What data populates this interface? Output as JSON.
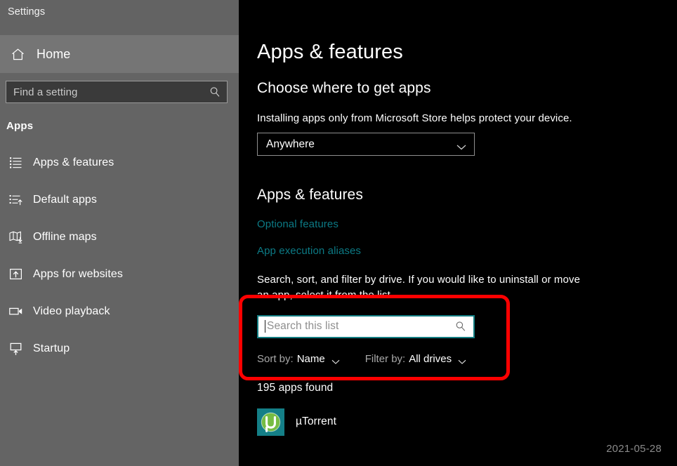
{
  "window": {
    "title": "Settings"
  },
  "sidebar": {
    "home": {
      "label": "Home",
      "icon": "home-icon"
    },
    "search": {
      "placeholder": "Find a setting",
      "value": "",
      "icon": "search-icon"
    },
    "section_header": "Apps",
    "items": [
      {
        "label": "Apps & features",
        "icon": "list-bullet-icon",
        "selected": true
      },
      {
        "label": "Default apps",
        "icon": "list-arrow-icon",
        "selected": false
      },
      {
        "label": "Offline maps",
        "icon": "map-download-icon",
        "selected": false
      },
      {
        "label": "Apps for websites",
        "icon": "box-upload-icon",
        "selected": false
      },
      {
        "label": "Video playback",
        "icon": "video-camera-icon",
        "selected": false
      },
      {
        "label": "Startup",
        "icon": "monitor-startup-icon",
        "selected": false
      }
    ]
  },
  "main": {
    "page_title": "Apps & features",
    "get_apps": {
      "heading": "Choose where to get apps",
      "description": "Installing apps only from Microsoft Store helps protect your device.",
      "selected_option": "Anywhere",
      "options": [
        "Anywhere"
      ],
      "chevron_icon": "chevron-down-icon"
    },
    "apps_features": {
      "heading": "Apps & features",
      "links": [
        {
          "label": "Optional features"
        },
        {
          "label": "App execution aliases"
        }
      ],
      "description": "Search, sort, and filter by drive. If you would like to uninstall or move an app, select it from the list.",
      "list_search": {
        "placeholder": "Search this list",
        "value": "",
        "icon": "search-icon"
      },
      "sort": {
        "label": "Sort by:",
        "value": "Name",
        "chevron_icon": "chevron-down-icon"
      },
      "filter": {
        "label": "Filter by:",
        "value": "All drives",
        "chevron_icon": "chevron-down-icon"
      },
      "count_text": "195 apps found",
      "apps": [
        {
          "name": "µTorrent",
          "icon": "utorrent-icon",
          "date": "2021-05-28"
        }
      ]
    }
  },
  "annotation": {
    "highlight_color": "#fe0000",
    "shape": "rounded-rectangle"
  },
  "colors": {
    "sidebar_bg": "#646464",
    "titlebar_bg": "#636363",
    "home_row_bg": "#757575",
    "main_bg": "#000000",
    "link_teal": "#0c7a85",
    "input_border_teal": "#127d82",
    "accent_red": "#fe0000",
    "utorrent_tile": "#147f87",
    "utorrent_circle": "#76bc43"
  }
}
